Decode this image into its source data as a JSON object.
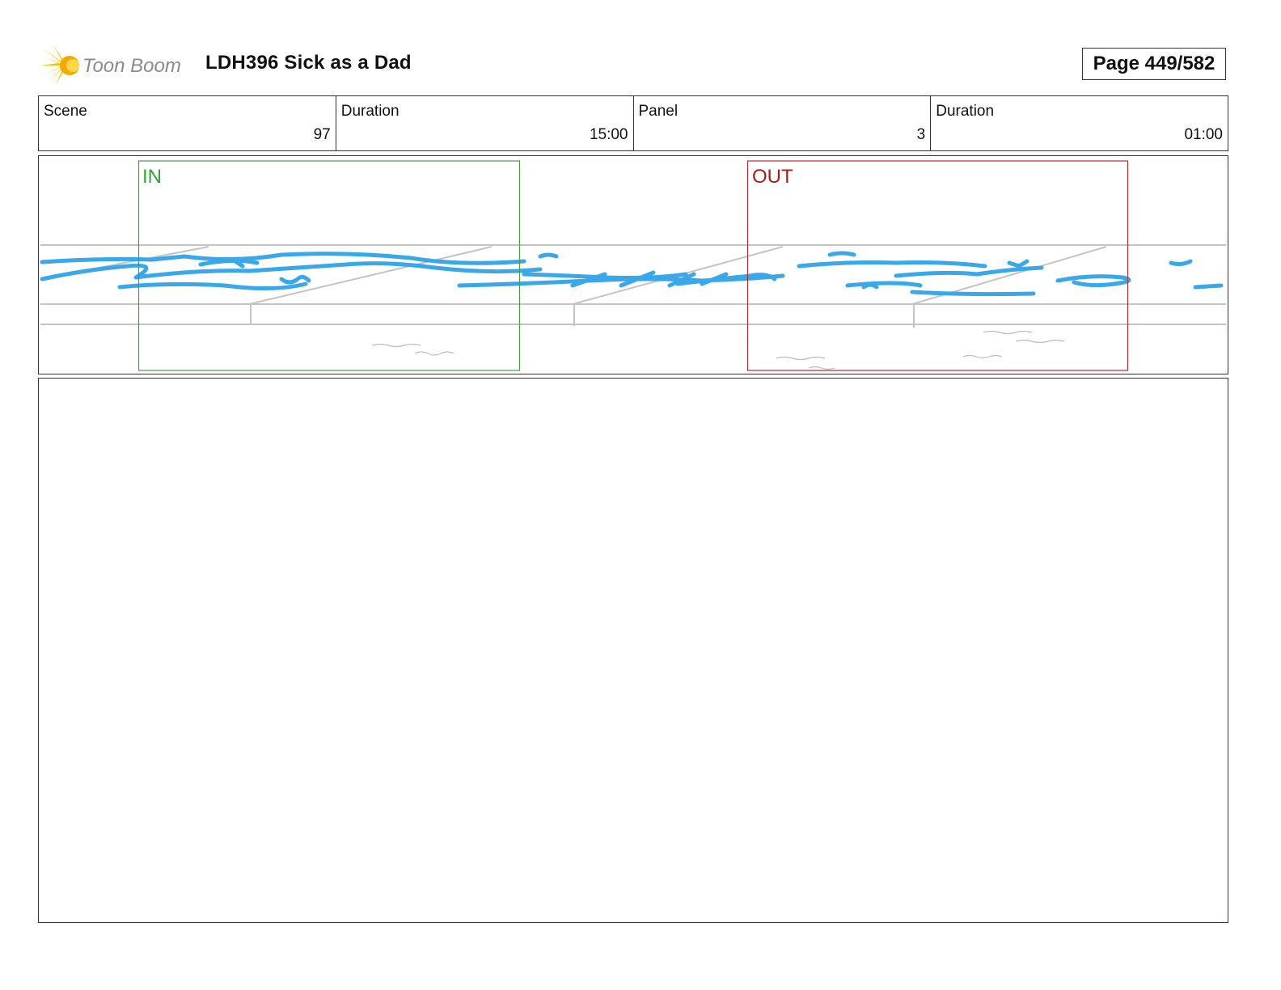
{
  "header": {
    "logo_text": "Toon Boom",
    "title": "LDH396 Sick as a Dad",
    "page": "Page 449/582"
  },
  "info": {
    "scene_label": "Scene",
    "scene_value": "97",
    "scene_duration_label": "Duration",
    "scene_duration_value": "15:00",
    "panel_label": "Panel",
    "panel_value": "3",
    "panel_duration_label": "Duration",
    "panel_duration_value": "01:00"
  },
  "panel": {
    "in_label": "IN",
    "out_label": "OUT",
    "colors": {
      "in_frame": "#4a9a4a",
      "out_frame": "#b03030",
      "water": "#3aa8e8",
      "pencil": "#bdbdbd"
    }
  },
  "dialog": {
    "text": ""
  }
}
